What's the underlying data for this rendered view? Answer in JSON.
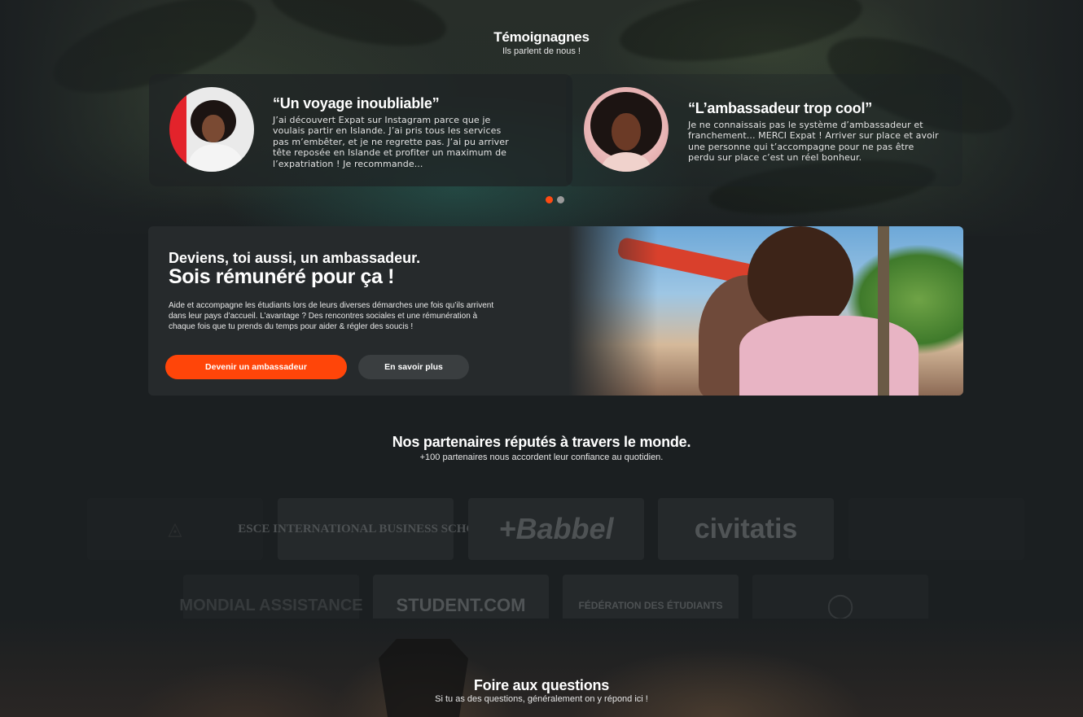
{
  "testimonials": {
    "title": "Témoignagnes",
    "subtitle": "Ils parlent de nous !",
    "items": [
      {
        "quote_title": "“Un voyage inoubliable”",
        "text": "J’ai découvert Expat sur Instagram parce que je voulais partir en Islande. J’ai pris tous les services pas m’embêter, et je ne regrette pas. J’ai pu arriver tête reposée en Islande et profiter un maximum de l’expatriation ! Je recommande..."
      },
      {
        "quote_title": "“L’ambassadeur trop cool”",
        "text": "Je ne connaissais pas le système d’ambassadeur et franchement... MERCI Expat ! Arriver sur place et avoir une personne qui t’accompagne pour ne pas être perdu sur place c’est un réel bonheur."
      }
    ],
    "carousel": {
      "active_index": 0,
      "count": 2
    }
  },
  "ambassador": {
    "heading": "Deviens, toi aussi, un ambassadeur.",
    "subheading": "Sois rémunéré pour ça !",
    "description": "Aide et accompagne les étudiants lors de leurs diverses démarches une fois qu’ils arrivent dans leur pays d’accueil. L’avantage ? Des rencontres sociales et une rémunération à chaque fois que tu prends du temps pour aider & régler des soucis !",
    "primary_button": "Devenir un ambassadeur",
    "secondary_button": "En savoir plus"
  },
  "partners": {
    "title": "Nos partenaires réputés à travers le monde.",
    "subtitle": "+100 partenaires nous accordent leur confiance au quotidien.",
    "row1": [
      "ESCE INTERNATIONAL BUSINESS SCHOOL",
      "+Babbel",
      "civitatis"
    ],
    "row2": [
      "MONDIAL ASSISTANCE",
      "STUDENT.COM",
      "FÉDÉRATION DES ÉTUDIANTS"
    ]
  },
  "faq": {
    "title": "Foire aux questions",
    "subtitle": "Si tu as des questions, généralement on y répond ici !"
  },
  "colors": {
    "accent": "#ff4509",
    "background": "#1b1f21",
    "card": "#262a2c"
  }
}
